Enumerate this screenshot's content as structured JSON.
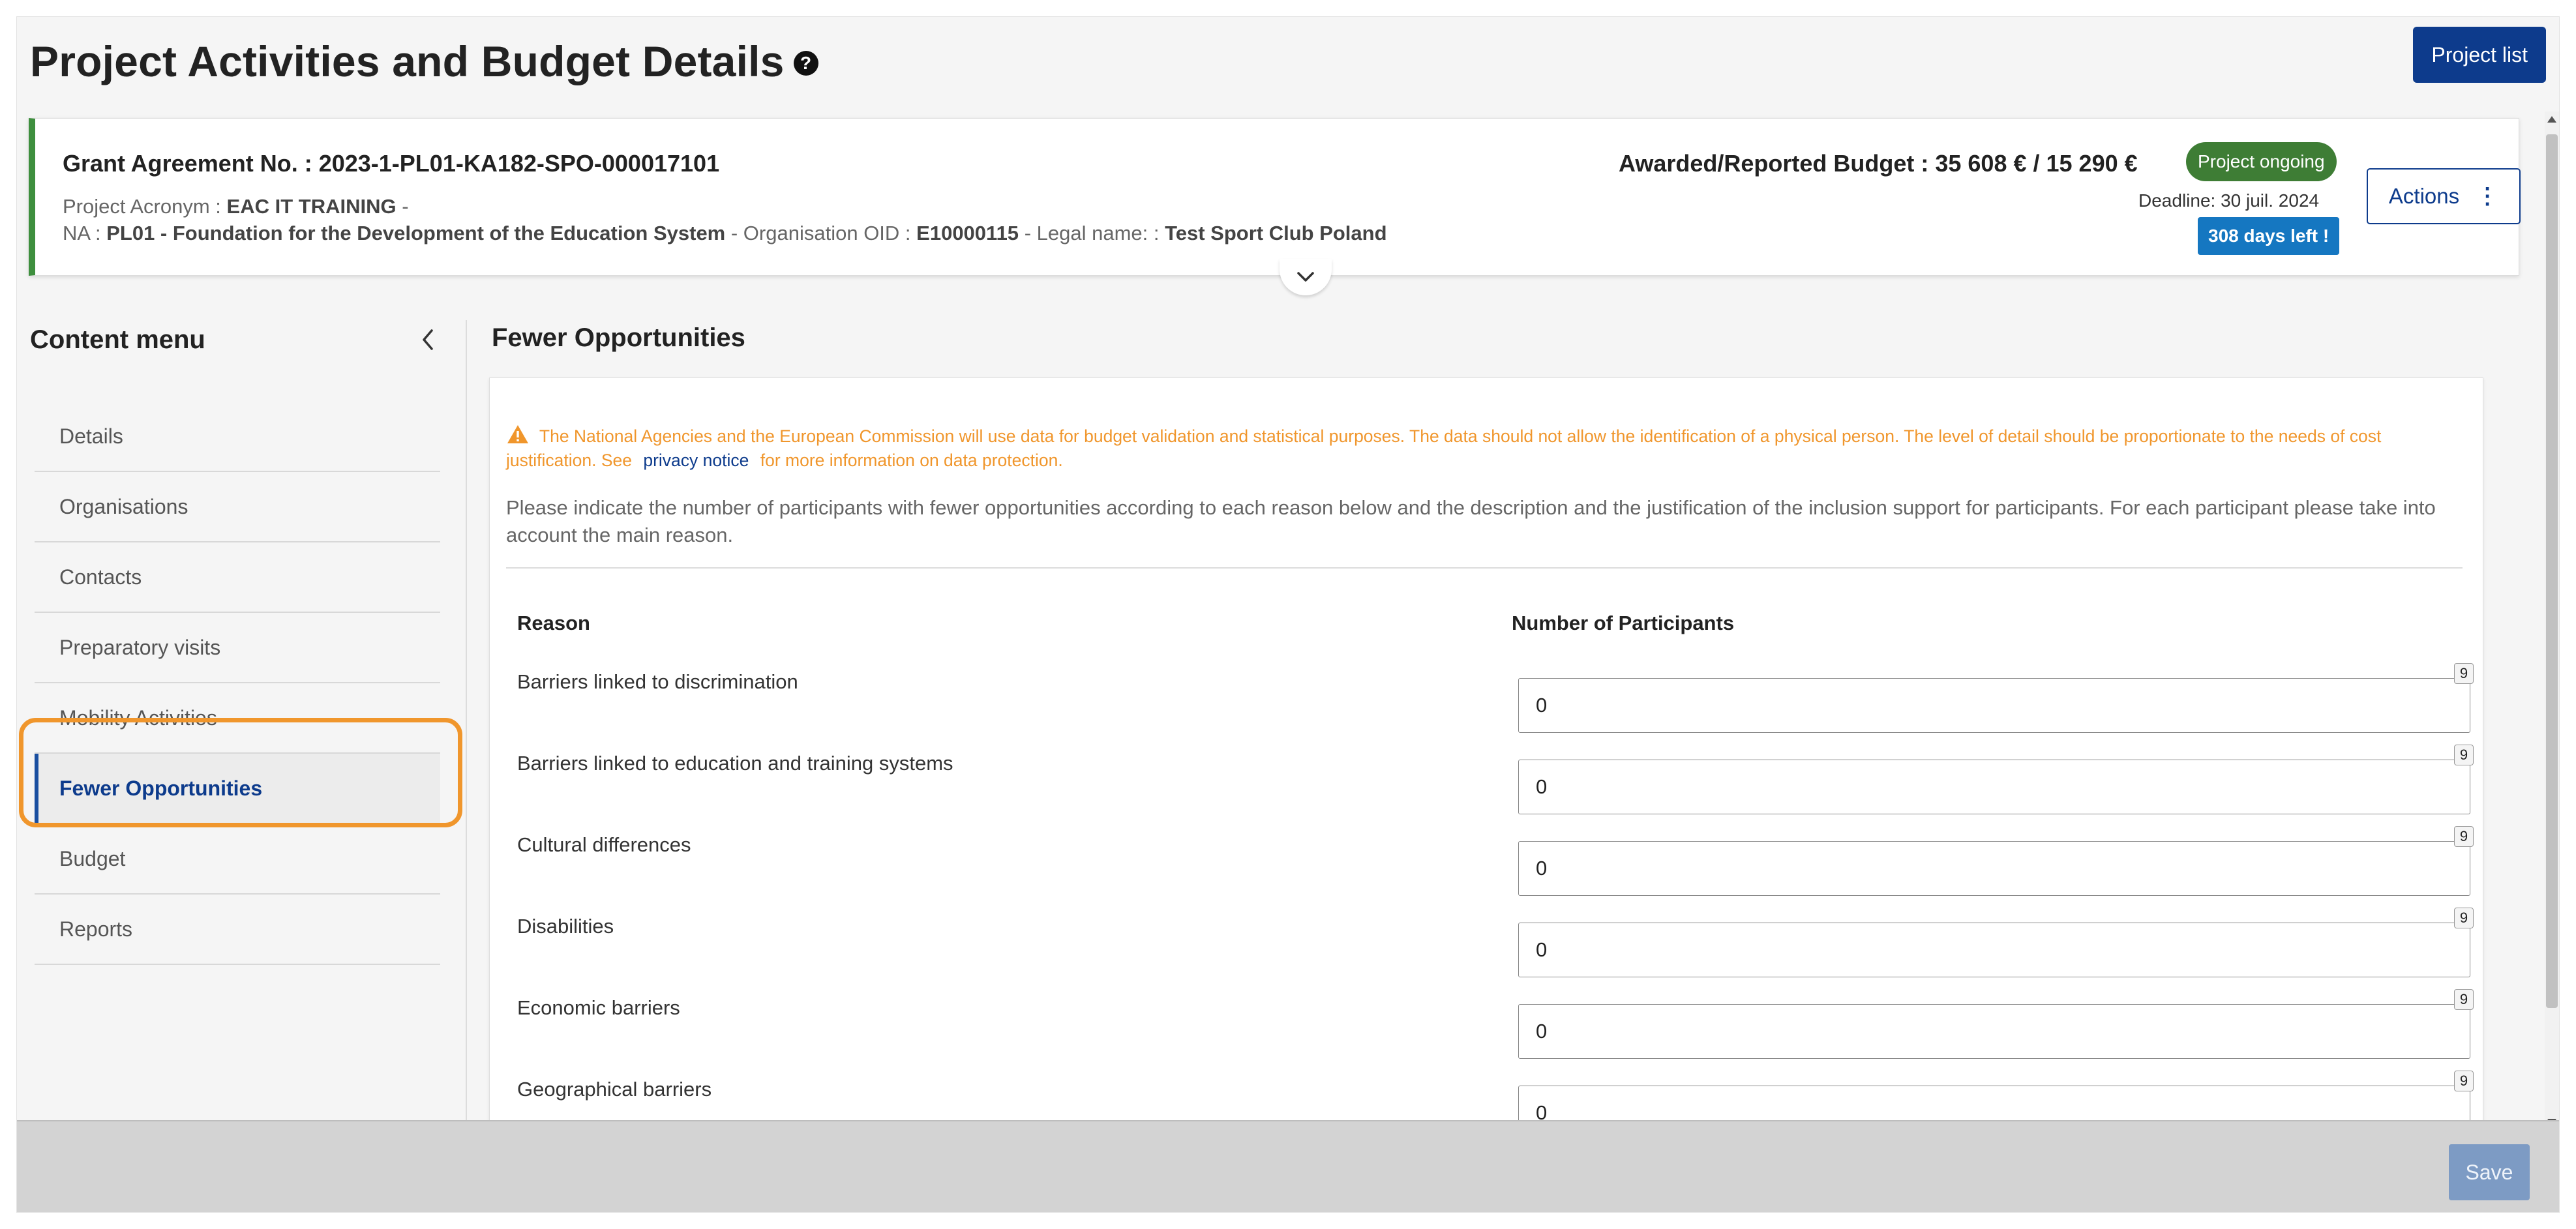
{
  "page": {
    "title": "Project Activities and Budget Details",
    "project_list_label": "Project list"
  },
  "grant": {
    "agreement": "Grant Agreement No. : 2023-1-PL01-KA182-SPO-000017101",
    "acronym_label": "Project Acronym :",
    "acronym_value": "EAC IT TRAINING",
    "na_label": "NA :",
    "na_value": "PL01 - Foundation for the Development of the Education System",
    "oid_label": "- Organisation OID :",
    "oid_value": "E10000115",
    "legal_label": "- Legal name: :",
    "legal_value": "Test Sport Club Poland",
    "budget": "Awarded/Reported Budget : 35 608 € / 15 290 €",
    "status": "Project ongoing",
    "deadline": "Deadline: 30 juil. 2024",
    "days_left": "308 days left !",
    "actions_label": "Actions"
  },
  "sidebar": {
    "title": "Content menu",
    "items": [
      {
        "label": "Details"
      },
      {
        "label": "Organisations"
      },
      {
        "label": "Contacts"
      },
      {
        "label": "Preparatory visits"
      },
      {
        "label": "Mobility Activities"
      },
      {
        "label": "Fewer Opportunities",
        "active": true
      },
      {
        "label": "Budget"
      },
      {
        "label": "Reports"
      }
    ]
  },
  "section": {
    "title": "Fewer Opportunities",
    "warning_text": "The National Agencies and the European Commission will use data for budget validation and statistical purposes. The data should not allow the identification of a physical person. The level of detail should be proportionate to the needs of cost justification. See",
    "privacy_link": "privacy notice",
    "warning_suffix": "for more information on data protection.",
    "instructions": "Please indicate the number of participants with fewer opportunities according to each reason below and the description and the justification of the inclusion support for participants. For each participant please take into account the main reason.",
    "col_reason": "Reason",
    "col_participants": "Number of Participants",
    "rows": [
      {
        "reason": "Barriers linked to discrimination",
        "value": "0",
        "counter": "9"
      },
      {
        "reason": "Barriers linked to education and training systems",
        "value": "0",
        "counter": "9"
      },
      {
        "reason": "Cultural differences",
        "value": "0",
        "counter": "9"
      },
      {
        "reason": "Disabilities",
        "value": "0",
        "counter": "9"
      },
      {
        "reason": "Economic barriers",
        "value": "0",
        "counter": "9"
      },
      {
        "reason": "Geographical barriers",
        "value": "0",
        "counter": "9"
      }
    ]
  },
  "footer": {
    "save_label": "Save"
  },
  "colors": {
    "primary": "#0d3b8c",
    "status_green": "#3e7d35",
    "days_blue": "#1577c1",
    "warning_orange": "#f0962c",
    "highlight_orange": "#f0962c"
  }
}
